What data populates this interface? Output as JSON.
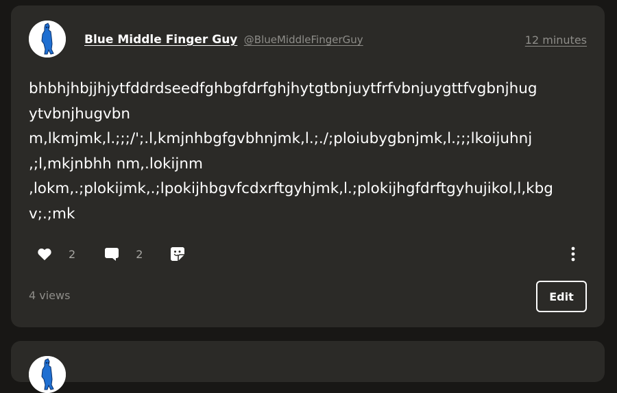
{
  "post": {
    "author_name": "Blue Middle Finger Guy",
    "author_handle": "@BlueMiddleFingerGuy",
    "timestamp": "12 minutes",
    "body_lines": [
      "bhbhjhbjjhjytfddrdseedfghbgfdrfghjhytgtbnjuytfrfvbnjuygttfvgbnjhug",
      "ytvbnjhugvbn",
      "m,lkmjmk,l.;;;/';.l,kmjnhbgfgvbhnjmk,l.;./;ploiubygbnjmk,l.;;;lkoijuhnj",
      ",;l,mkjnbhh nm,.lokijnm",
      ",lokm,.;plokijmk,.;lpokijhbgvfcdxrftgyhjmk,l.;plokijhgfdrftgyhujikol,l,kbg",
      "v;.;mk"
    ],
    "likes_count": "2",
    "comments_count": "2",
    "views": "4 views",
    "edit_label": "Edit"
  },
  "icons": {
    "like": "heart-icon",
    "comment": "comment-bubble-icon",
    "share": "share-sticker-icon",
    "more": "more-vertical-icon"
  },
  "colors": {
    "page_bg": "#181715",
    "card_bg": "#2b2a27",
    "muted_text": "#8e8d89",
    "avatar_blue": "#1f6fd1"
  }
}
